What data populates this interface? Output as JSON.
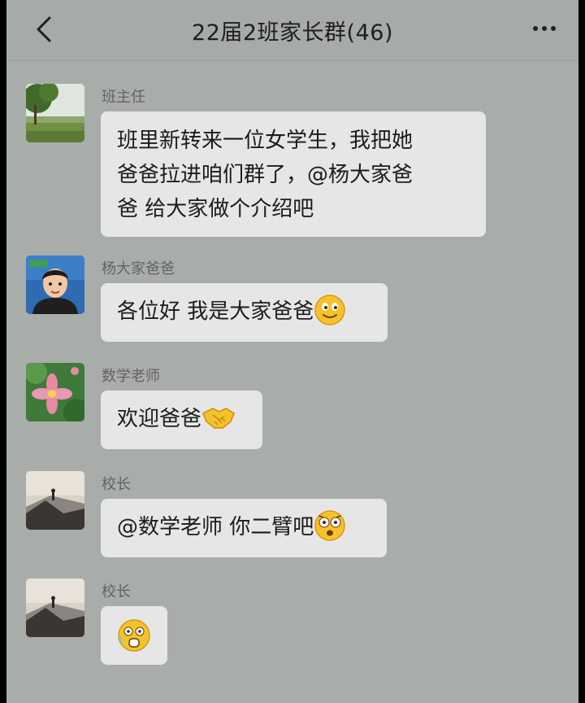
{
  "header": {
    "title": "22届2班家长群(46)",
    "back_icon": "chevron-left-icon",
    "more_icon": "more-dots-icon"
  },
  "messages": [
    {
      "sender": "班主任",
      "avatar": "landscape-tree-avatar",
      "lines": [
        "班里新转来一位女学生，我把她",
        "爸爸拉进咱们群了，@杨大家爸",
        "爸 给大家做个介绍吧"
      ]
    },
    {
      "sender": "杨大家爸爸",
      "avatar": "cartoon-man-avatar",
      "text": "各位好 我是大家爸爸",
      "emoji": "smile-emoji"
    },
    {
      "sender": "数学老师",
      "avatar": "pink-flower-avatar",
      "text": "欢迎爸爸",
      "emoji": "handshake-emoji"
    },
    {
      "sender": "校长",
      "avatar": "hill-silhouette-avatar",
      "text": "@数学老师 你二臂吧",
      "emoji": "shocked-emoji"
    },
    {
      "sender": "校长",
      "avatar": "hill-silhouette-avatar",
      "emoji": "scared-emoji"
    }
  ],
  "colors": {
    "background": "#a9ada9",
    "bubble": "#e6e6e6",
    "sender_text": "#616461"
  }
}
